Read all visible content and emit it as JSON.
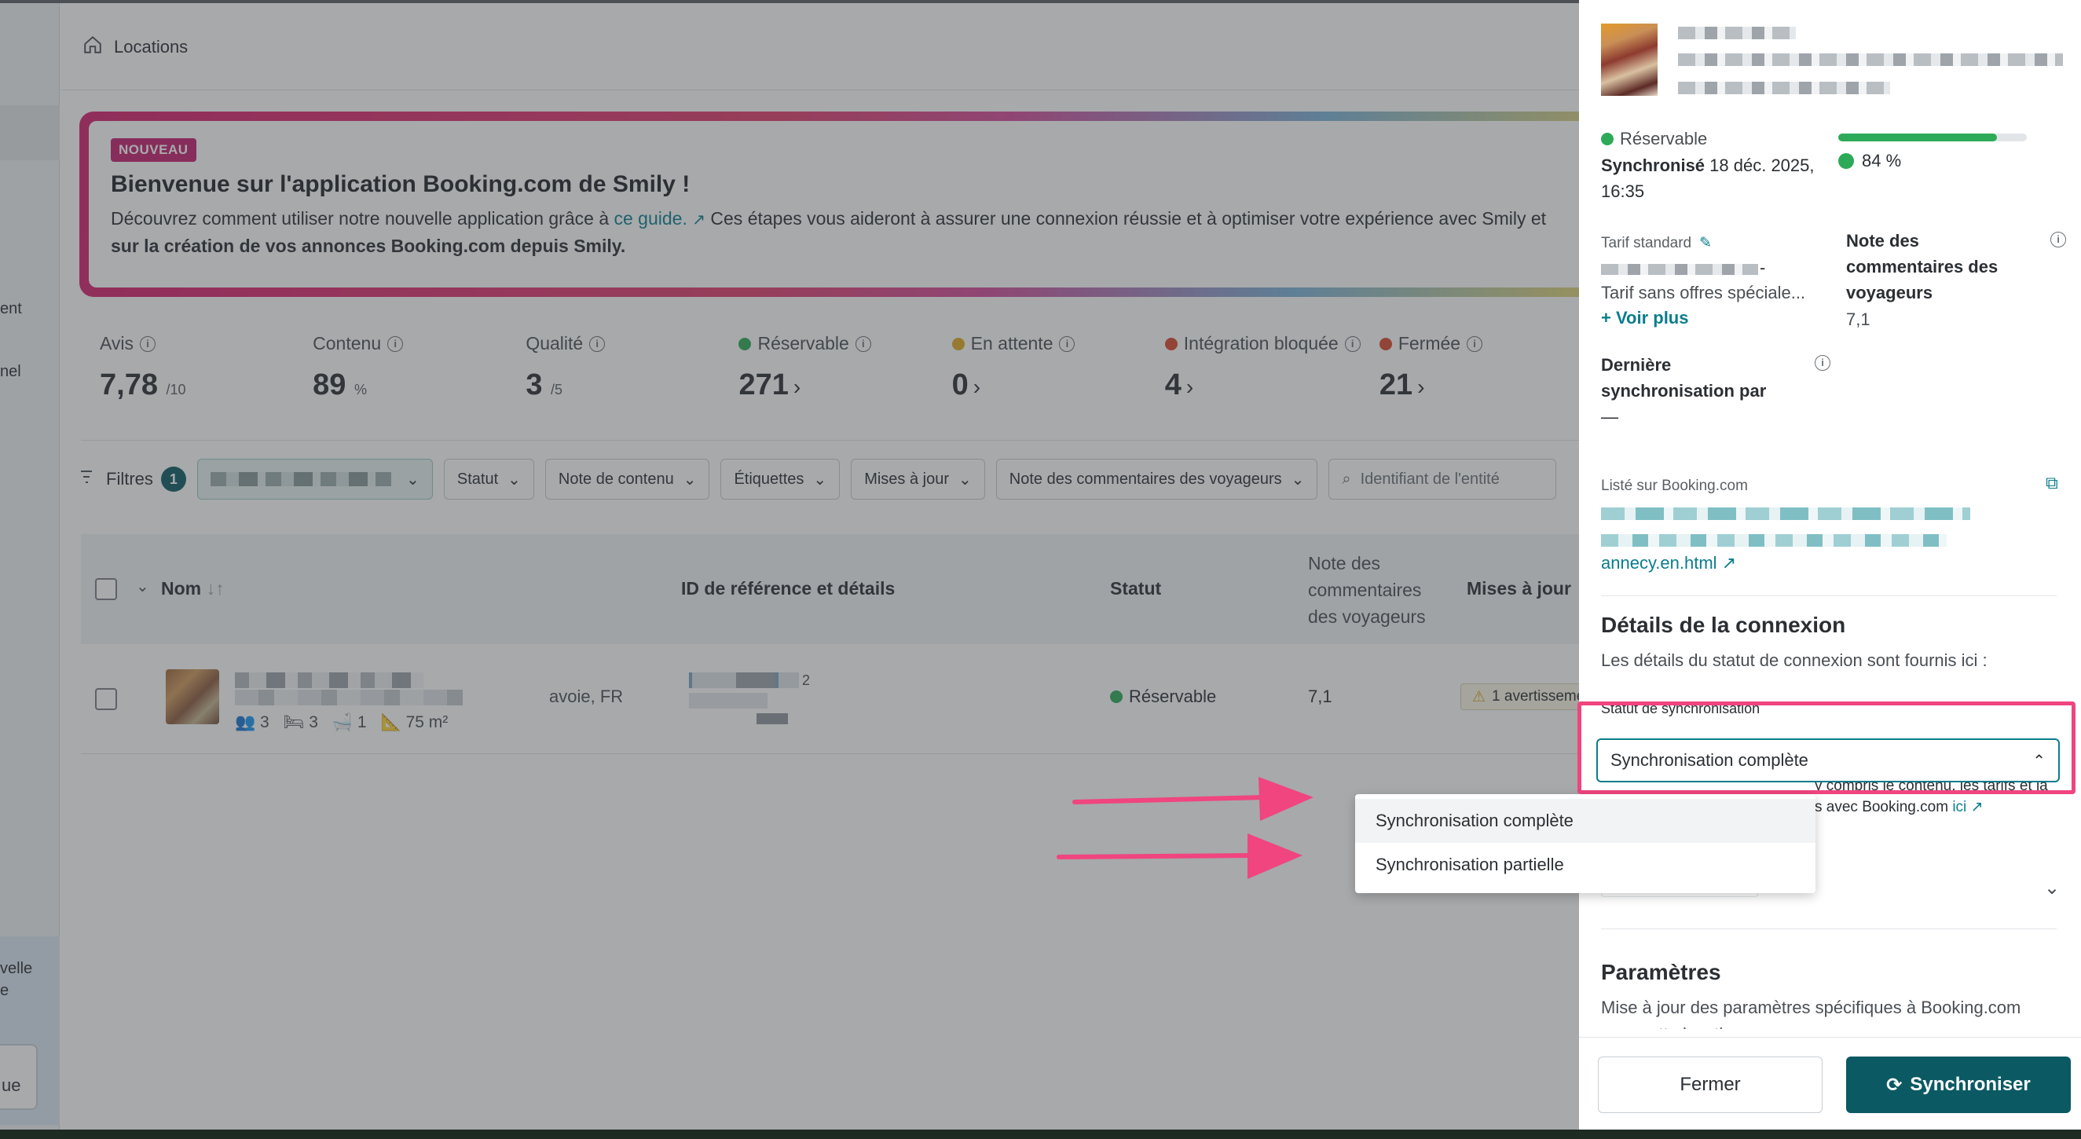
{
  "breadcrumb": {
    "label": "Locations"
  },
  "banner": {
    "badge": "NOUVEAU",
    "title": "Bienvenue sur l'application Booking.com de Smily !",
    "text_before_link": "Découvrez comment utiliser notre nouvelle application grâce à ",
    "link": "ce guide.",
    "text_after_link": " Ces étapes vous aideront à assurer une connexion réussie et à optimiser votre expérience avec Smily et",
    "text_line2": "sur la création de vos annonces Booking.com depuis Smily."
  },
  "stats": [
    {
      "label": "Avis",
      "value": "7,78",
      "unit": "/10",
      "dot": ""
    },
    {
      "label": "Contenu",
      "value": "89",
      "unit": "%",
      "dot": ""
    },
    {
      "label": "Qualité",
      "value": "3",
      "unit": "/5",
      "dot": ""
    },
    {
      "label": "Réservable",
      "value": "271",
      "unit": "",
      "dot": "#2daa57"
    },
    {
      "label": "En attente",
      "value": "0",
      "unit": "",
      "dot": "#e0a91e"
    },
    {
      "label": "Intégration bloquée",
      "value": "4",
      "unit": "",
      "dot": "#d9472b"
    },
    {
      "label": "Fermée",
      "value": "21",
      "unit": "",
      "dot": "#d9472b"
    }
  ],
  "filters": {
    "label": "Filtres",
    "count": "1",
    "buttons": [
      "Statut",
      "Note de contenu",
      "Étiquettes",
      "Mises à jour",
      "Note des commentaires des voyageurs"
    ],
    "search_placeholder": "Identifiant de l'entité"
  },
  "table": {
    "headers": {
      "name": "Nom",
      "ref": "ID de référence et détails",
      "status": "Statut",
      "rating": "Note des commentaires des voyageurs",
      "updates": "Mises à jour"
    },
    "row": {
      "location": "avoie, FR",
      "guests": "3",
      "beds": "3",
      "baths": "1",
      "area": "75 m²",
      "ref_suffix": "2",
      "status": "Réservable",
      "rating": "7,1",
      "updates": "1 avertissement"
    }
  },
  "panel": {
    "status": "Réservable",
    "progress_percent": 84,
    "progress_label": "84 %",
    "synced_label": "Synchronisé",
    "synced_date": "18 déc. 2025, 16:35",
    "rate_label": "Tarif standard",
    "rate_suffix": "-",
    "rate_desc": "Tarif sans offres spéciale...",
    "see_more": "Voir plus",
    "review_label": "Note des commentaires des voyageurs",
    "review_value": "7,1",
    "last_sync_label": "Dernière synchronisation par",
    "last_sync_value": "—",
    "listed_label": "Listé sur Booking.com",
    "listed_url_end": "annecy.en.html",
    "connection_title": "Détails de la connexion",
    "connection_desc": "Les détails du statut de connexion sont fournis ici :",
    "sync_status_label": "Statut de synchronisation",
    "sync_status_value": "Synchronisation complète",
    "sync_help_1": "y compris le contenu, les tarifs et la",
    "sync_help_2": "s avec Booking.com",
    "sync_help_link": "ici",
    "params_title": "Paramètres",
    "params_desc": "Mise à jour des paramètres spécifiques à Booking.com",
    "params_desc2": "pour cette location :"
  },
  "dropdown": {
    "options": [
      "Synchronisation complète",
      "Synchronisation partielle"
    ]
  },
  "footer": {
    "close": "Fermer",
    "sync": "Synchroniser"
  },
  "left_rail": {
    "text1": "ent",
    "text2": "nel",
    "text3": "velle",
    "text4": "e",
    "button": "ue"
  },
  "colors": {
    "accent": "#0a7d8c",
    "primary_button": "#0b5963",
    "highlight": "#f0457f",
    "success": "#2daa57"
  }
}
